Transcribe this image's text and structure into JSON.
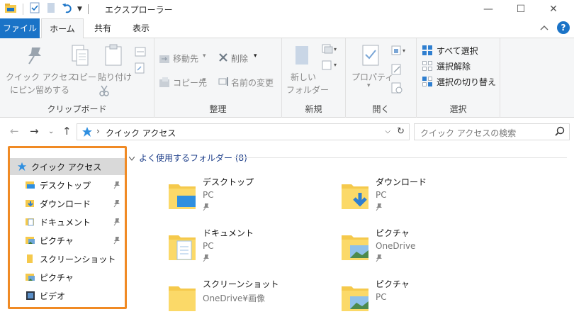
{
  "window": {
    "title": "エクスプローラー",
    "minimize_glyph": "—",
    "maximize_glyph": "☐",
    "close_glyph": "✕"
  },
  "ribbon_tabs": {
    "file": "ファイル",
    "home": "ホーム",
    "share": "共有",
    "view": "表示"
  },
  "ribbon": {
    "clipboard": {
      "pin_label_1": "クイック アクセス",
      "pin_label_2": "にピン留めする",
      "copy": "コピー",
      "paste": "貼り付け",
      "group": "クリップボード"
    },
    "organize": {
      "move_to": "移動先",
      "copy_to": "コピー先",
      "delete": "削除",
      "rename": "名前の変更",
      "group": "整理"
    },
    "new": {
      "new_folder_1": "新しい",
      "new_folder_2": "フォルダー",
      "group": "新規"
    },
    "open": {
      "properties": "プロパティ",
      "group": "開く"
    },
    "select": {
      "select_all": "すべて選択",
      "select_none": "選択解除",
      "invert": "選択の切り替え",
      "group": "選択"
    }
  },
  "address": {
    "path": "クイック アクセス",
    "search_placeholder": "クイック アクセスの検索"
  },
  "nav_pane": {
    "items": [
      {
        "label": "クイック アクセス",
        "pinned": false
      },
      {
        "label": "デスクトップ",
        "pinned": true
      },
      {
        "label": "ダウンロード",
        "pinned": true
      },
      {
        "label": "ドキュメント",
        "pinned": true
      },
      {
        "label": "ピクチャ",
        "pinned": true
      },
      {
        "label": "スクリーンショット",
        "pinned": false
      },
      {
        "label": "ピクチャ",
        "pinned": false
      },
      {
        "label": "ビデオ",
        "pinned": false
      }
    ]
  },
  "content": {
    "section_title": "よく使用するフォルダー (8)",
    "folders": [
      {
        "name": "デスクトップ",
        "location": "PC",
        "pinned": true
      },
      {
        "name": "ダウンロード",
        "location": "PC",
        "pinned": true
      },
      {
        "name": "ドキュメント",
        "location": "PC",
        "pinned": true
      },
      {
        "name": "ピクチャ",
        "location": "OneDrive",
        "pinned": true
      },
      {
        "name": "スクリーンショット",
        "location": "OneDrive¥画像",
        "pinned": false
      },
      {
        "name": "ピクチャ",
        "location": "PC",
        "pinned": false
      }
    ]
  },
  "colors": {
    "accent": "#1a73c7",
    "folder_yellow": "#f5c94c",
    "highlight_border": "#f08a24",
    "section_title": "#1e3f8a"
  }
}
